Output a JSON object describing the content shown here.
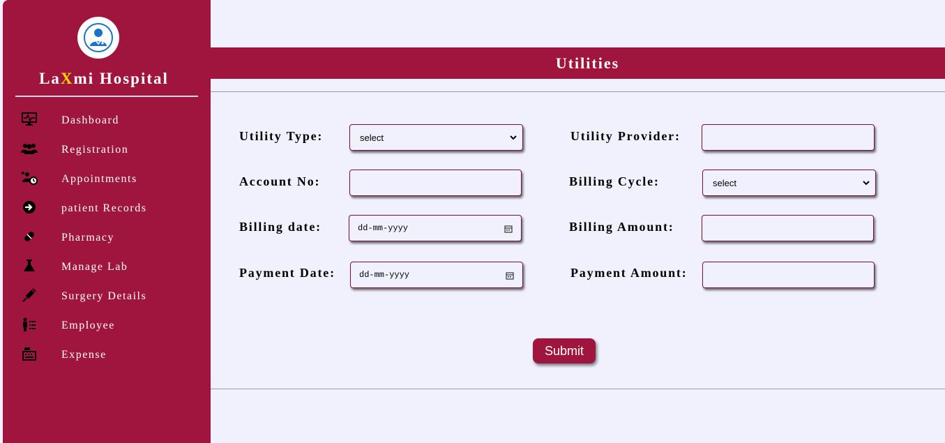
{
  "brand": {
    "prefix": "La",
    "accent": "X",
    "suffix": "mi Hospital"
  },
  "sidebar": {
    "items": [
      {
        "label": "Dashboard",
        "icon": "monitor-icon"
      },
      {
        "label": "Registration",
        "icon": "users-icon"
      },
      {
        "label": "Appointments",
        "icon": "user-clock-icon"
      },
      {
        "label": "patient Records",
        "icon": "sign-in-icon"
      },
      {
        "label": "Pharmacy",
        "icon": "pill-icon"
      },
      {
        "label": "Manage Lab",
        "icon": "flask-icon"
      },
      {
        "label": "Surgery Details",
        "icon": "syringe-icon"
      },
      {
        "label": "Employee",
        "icon": "person-list-icon"
      },
      {
        "label": "Expense",
        "icon": "cash-register-icon"
      }
    ]
  },
  "page": {
    "title": "Utilities"
  },
  "form": {
    "utility_type": {
      "label": "Utility Type:",
      "value": "select"
    },
    "utility_provider": {
      "label": "Utility Provider:",
      "value": ""
    },
    "account_no": {
      "label": "Account No:",
      "value": ""
    },
    "billing_cycle": {
      "label": "Billing Cycle:",
      "value": "select"
    },
    "billing_date": {
      "label": "Billing date:",
      "placeholder": "dd-mm-yyyy"
    },
    "billing_amount": {
      "label": "Billing Amount:",
      "value": ""
    },
    "payment_date": {
      "label": "Payment Date:",
      "placeholder": "dd-mm-yyyy"
    },
    "payment_amount": {
      "label": "Payment Amount:",
      "value": ""
    },
    "submit_label": "Submit"
  },
  "colors": {
    "primary": "#a0153e",
    "background": "#f0f1fd",
    "accent": "#ffd700"
  }
}
